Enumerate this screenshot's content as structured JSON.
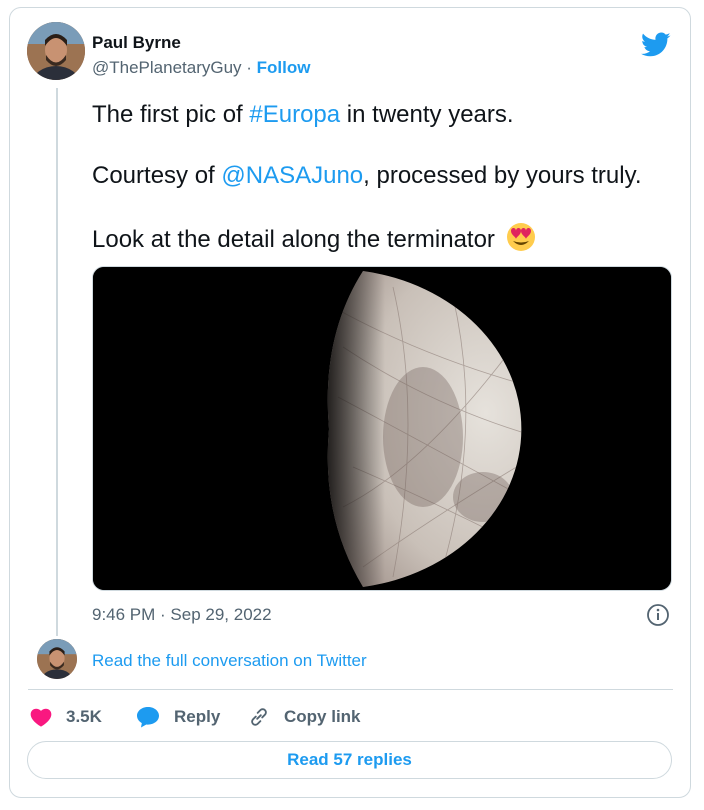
{
  "author": {
    "name": "Paul Byrne",
    "handle": "@ThePlanetaryGuy",
    "separator": " · ",
    "follow_label": "Follow"
  },
  "tweet": {
    "line1_pre": "The first pic of ",
    "line1_hashtag": "#Europa",
    "line1_post": " in twenty years.",
    "line2_pre": "Courtesy of ",
    "line2_mention": "@NASAJuno",
    "line2_post": ", processed by yours truly.",
    "line3": "Look at the detail along the terminator",
    "line3_emoji": "heart-eyes-emoji"
  },
  "media": {
    "image": "europa-half-lit-photo"
  },
  "timestamp": "9:46 PM · Sep 29, 2022",
  "read_conversation": "Read the full conversation on Twitter",
  "actions": {
    "likes_count": "3.5K",
    "reply_label": "Reply",
    "copy_link_label": "Copy link"
  },
  "read_replies_label": "Read 57 replies",
  "colors": {
    "accent": "#1d9bf0",
    "like": "#f91880",
    "text": "#0f1419",
    "muted": "#536471",
    "border": "#cfd9de"
  }
}
